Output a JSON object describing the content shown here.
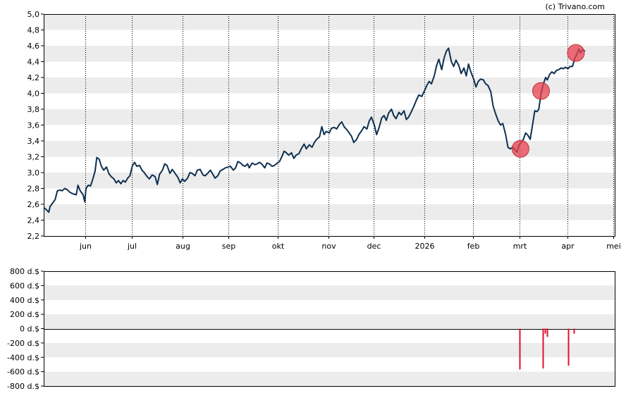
{
  "credit": "(c) Trivano.com",
  "colors": {
    "line": "#0e3050",
    "band": "#ececec",
    "marker": "#e8404f",
    "volume": "#e0102a",
    "axis": "#000000",
    "grid": "#000000"
  },
  "chart_data": [
    {
      "type": "line",
      "title": "",
      "ylim": [
        2.2,
        5.0
      ],
      "y_ticks": [
        "2,2",
        "2,4",
        "2,6",
        "2,8",
        "3,0",
        "3,2",
        "3,4",
        "3,6",
        "3,8",
        "4,0",
        "4,2",
        "4,4",
        "4,6",
        "4,8",
        "5,0"
      ],
      "x_ticks": [
        {
          "label": "jun",
          "x": 0.0727
        },
        {
          "label": "jul",
          "x": 0.1546
        },
        {
          "label": "aug",
          "x": 0.243
        },
        {
          "label": "sep",
          "x": 0.324
        },
        {
          "label": "okt",
          "x": 0.41
        },
        {
          "label": "nov",
          "x": 0.499
        },
        {
          "label": "dec",
          "x": 0.578
        },
        {
          "label": "2026",
          "x": 0.667
        },
        {
          "label": "feb",
          "x": 0.752
        },
        {
          "label": "mrt",
          "x": 0.833
        },
        {
          "label": "apr",
          "x": 0.917
        },
        {
          "label": "mei",
          "x": 0.998
        }
      ],
      "series": [
        {
          "points": [
            [
              0.0,
              2.56
            ],
            [
              0.005,
              2.53
            ],
            [
              0.009,
              2.5
            ],
            [
              0.011,
              2.57
            ],
            [
              0.016,
              2.62
            ],
            [
              0.02,
              2.66
            ],
            [
              0.024,
              2.77
            ],
            [
              0.029,
              2.78
            ],
            [
              0.032,
              2.77
            ],
            [
              0.037,
              2.8
            ],
            [
              0.042,
              2.78
            ],
            [
              0.046,
              2.75
            ],
            [
              0.052,
              2.73
            ],
            [
              0.057,
              2.72
            ],
            [
              0.06,
              2.84
            ],
            [
              0.064,
              2.77
            ],
            [
              0.069,
              2.72
            ],
            [
              0.072,
              2.63
            ],
            [
              0.074,
              2.8
            ],
            [
              0.078,
              2.84
            ],
            [
              0.082,
              2.83
            ],
            [
              0.086,
              2.92
            ],
            [
              0.09,
              3.02
            ],
            [
              0.093,
              3.19
            ],
            [
              0.097,
              3.17
            ],
            [
              0.101,
              3.08
            ],
            [
              0.105,
              3.03
            ],
            [
              0.11,
              3.07
            ],
            [
              0.114,
              2.99
            ],
            [
              0.118,
              2.95
            ],
            [
              0.123,
              2.92
            ],
            [
              0.127,
              2.87
            ],
            [
              0.131,
              2.9
            ],
            [
              0.135,
              2.86
            ],
            [
              0.139,
              2.9
            ],
            [
              0.143,
              2.88
            ],
            [
              0.147,
              2.93
            ],
            [
              0.151,
              2.96
            ],
            [
              0.155,
              3.08
            ],
            [
              0.159,
              3.13
            ],
            [
              0.163,
              3.08
            ],
            [
              0.168,
              3.09
            ],
            [
              0.172,
              3.03
            ],
            [
              0.176,
              3.0
            ],
            [
              0.181,
              2.95
            ],
            [
              0.185,
              2.92
            ],
            [
              0.19,
              2.97
            ],
            [
              0.195,
              2.95
            ],
            [
              0.199,
              2.85
            ],
            [
              0.203,
              2.98
            ],
            [
              0.208,
              3.03
            ],
            [
              0.212,
              3.11
            ],
            [
              0.216,
              3.09
            ],
            [
              0.221,
              2.99
            ],
            [
              0.225,
              3.04
            ],
            [
              0.23,
              2.99
            ],
            [
              0.235,
              2.94
            ],
            [
              0.239,
              2.87
            ],
            [
              0.243,
              2.92
            ],
            [
              0.247,
              2.89
            ],
            [
              0.252,
              2.93
            ],
            [
              0.256,
              3.0
            ],
            [
              0.26,
              2.99
            ],
            [
              0.265,
              2.96
            ],
            [
              0.269,
              3.03
            ],
            [
              0.274,
              3.04
            ],
            [
              0.279,
              2.97
            ],
            [
              0.283,
              2.96
            ],
            [
              0.287,
              2.99
            ],
            [
              0.292,
              3.03
            ],
            [
              0.296,
              2.98
            ],
            [
              0.3,
              2.93
            ],
            [
              0.305,
              2.96
            ],
            [
              0.309,
              3.02
            ],
            [
              0.314,
              3.04
            ],
            [
              0.318,
              3.06
            ],
            [
              0.323,
              3.07
            ],
            [
              0.327,
              3.08
            ],
            [
              0.332,
              3.03
            ],
            [
              0.336,
              3.06
            ],
            [
              0.34,
              3.14
            ],
            [
              0.345,
              3.12
            ],
            [
              0.349,
              3.09
            ],
            [
              0.353,
              3.08
            ],
            [
              0.357,
              3.11
            ],
            [
              0.36,
              3.06
            ],
            [
              0.365,
              3.12
            ],
            [
              0.37,
              3.1
            ],
            [
              0.374,
              3.11
            ],
            [
              0.378,
              3.13
            ],
            [
              0.383,
              3.1
            ],
            [
              0.387,
              3.06
            ],
            [
              0.391,
              3.12
            ],
            [
              0.395,
              3.11
            ],
            [
              0.4,
              3.08
            ],
            [
              0.404,
              3.09
            ],
            [
              0.409,
              3.12
            ],
            [
              0.413,
              3.14
            ],
            [
              0.417,
              3.2
            ],
            [
              0.421,
              3.27
            ],
            [
              0.425,
              3.25
            ],
            [
              0.429,
              3.22
            ],
            [
              0.434,
              3.25
            ],
            [
              0.438,
              3.18
            ],
            [
              0.442,
              3.22
            ],
            [
              0.447,
              3.24
            ],
            [
              0.451,
              3.3
            ],
            [
              0.456,
              3.36
            ],
            [
              0.46,
              3.3
            ],
            [
              0.465,
              3.35
            ],
            [
              0.47,
              3.32
            ],
            [
              0.474,
              3.38
            ],
            [
              0.478,
              3.42
            ],
            [
              0.483,
              3.45
            ],
            [
              0.487,
              3.58
            ],
            [
              0.491,
              3.48
            ],
            [
              0.495,
              3.52
            ],
            [
              0.5,
              3.5
            ],
            [
              0.504,
              3.56
            ],
            [
              0.509,
              3.57
            ],
            [
              0.513,
              3.55
            ],
            [
              0.518,
              3.61
            ],
            [
              0.522,
              3.64
            ],
            [
              0.526,
              3.58
            ],
            [
              0.531,
              3.54
            ],
            [
              0.535,
              3.5
            ],
            [
              0.539,
              3.46
            ],
            [
              0.543,
              3.38
            ],
            [
              0.548,
              3.42
            ],
            [
              0.552,
              3.48
            ],
            [
              0.557,
              3.53
            ],
            [
              0.561,
              3.58
            ],
            [
              0.566,
              3.55
            ],
            [
              0.57,
              3.65
            ],
            [
              0.574,
              3.7
            ],
            [
              0.579,
              3.6
            ],
            [
              0.583,
              3.48
            ],
            [
              0.587,
              3.56
            ],
            [
              0.592,
              3.69
            ],
            [
              0.596,
              3.72
            ],
            [
              0.6,
              3.66
            ],
            [
              0.604,
              3.75
            ],
            [
              0.609,
              3.8
            ],
            [
              0.613,
              3.72
            ],
            [
              0.617,
              3.68
            ],
            [
              0.622,
              3.76
            ],
            [
              0.626,
              3.73
            ],
            [
              0.631,
              3.78
            ],
            [
              0.635,
              3.67
            ],
            [
              0.639,
              3.7
            ],
            [
              0.644,
              3.77
            ],
            [
              0.649,
              3.85
            ],
            [
              0.653,
              3.92
            ],
            [
              0.657,
              3.98
            ],
            [
              0.662,
              3.96
            ],
            [
              0.666,
              4.02
            ],
            [
              0.671,
              4.1
            ],
            [
              0.675,
              4.15
            ],
            [
              0.679,
              4.12
            ],
            [
              0.684,
              4.22
            ],
            [
              0.688,
              4.35
            ],
            [
              0.692,
              4.43
            ],
            [
              0.697,
              4.3
            ],
            [
              0.701,
              4.44
            ],
            [
              0.705,
              4.53
            ],
            [
              0.709,
              4.57
            ],
            [
              0.714,
              4.4
            ],
            [
              0.718,
              4.34
            ],
            [
              0.722,
              4.42
            ],
            [
              0.727,
              4.35
            ],
            [
              0.731,
              4.25
            ],
            [
              0.736,
              4.32
            ],
            [
              0.74,
              4.22
            ],
            [
              0.744,
              4.37
            ],
            [
              0.748,
              4.27
            ],
            [
              0.753,
              4.18
            ],
            [
              0.757,
              4.08
            ],
            [
              0.761,
              4.15
            ],
            [
              0.765,
              4.18
            ],
            [
              0.77,
              4.17
            ],
            [
              0.774,
              4.12
            ],
            [
              0.778,
              4.1
            ],
            [
              0.783,
              4.02
            ],
            [
              0.787,
              3.84
            ],
            [
              0.791,
              3.75
            ],
            [
              0.796,
              3.65
            ],
            [
              0.8,
              3.6
            ],
            [
              0.804,
              3.62
            ],
            [
              0.809,
              3.48
            ],
            [
              0.813,
              3.32
            ],
            [
              0.817,
              3.3
            ],
            [
              0.822,
              3.32
            ],
            [
              0.826,
              3.28
            ],
            [
              0.829,
              3.26
            ],
            [
              0.832,
              3.34
            ],
            [
              0.836,
              3.38
            ],
            [
              0.84,
              3.42
            ],
            [
              0.844,
              3.5
            ],
            [
              0.848,
              3.47
            ],
            [
              0.852,
              3.42
            ],
            [
              0.856,
              3.6
            ],
            [
              0.86,
              3.78
            ],
            [
              0.864,
              3.77
            ],
            [
              0.867,
              3.8
            ],
            [
              0.871,
              4.0
            ],
            [
              0.875,
              4.12
            ],
            [
              0.879,
              4.2
            ],
            [
              0.882,
              4.17
            ],
            [
              0.886,
              4.24
            ],
            [
              0.89,
              4.27
            ],
            [
              0.894,
              4.25
            ],
            [
              0.898,
              4.29
            ],
            [
              0.902,
              4.3
            ],
            [
              0.906,
              4.32
            ],
            [
              0.91,
              4.31
            ],
            [
              0.914,
              4.33
            ],
            [
              0.918,
              4.31
            ],
            [
              0.922,
              4.34
            ],
            [
              0.926,
              4.34
            ],
            [
              0.93,
              4.44
            ],
            [
              0.934,
              4.5
            ],
            [
              0.937,
              4.56
            ],
            [
              0.94,
              4.51
            ],
            [
              0.944,
              4.55
            ],
            [
              0.948,
              4.53
            ]
          ]
        }
      ],
      "markers": [
        {
          "x": 0.835,
          "y": 3.3
        },
        {
          "x": 0.871,
          "y": 4.03
        },
        {
          "x": 0.932,
          "y": 4.51
        }
      ]
    },
    {
      "type": "bar",
      "title": "",
      "ylim": [
        -800,
        800
      ],
      "y_ticks": [
        "800 d.$",
        "600 d.$",
        "400 d.$",
        "200 d.$",
        "0 d.$",
        "-200 d.$",
        "-400 d.$",
        "-600 d.$",
        "-800 d.$"
      ],
      "bars": [
        {
          "x": 0.833,
          "value": -570
        },
        {
          "x": 0.874,
          "value": -555
        },
        {
          "x": 0.878,
          "value": -70
        },
        {
          "x": 0.882,
          "value": -115
        },
        {
          "x": 0.919,
          "value": -515
        },
        {
          "x": 0.929,
          "value": -70
        }
      ]
    }
  ]
}
